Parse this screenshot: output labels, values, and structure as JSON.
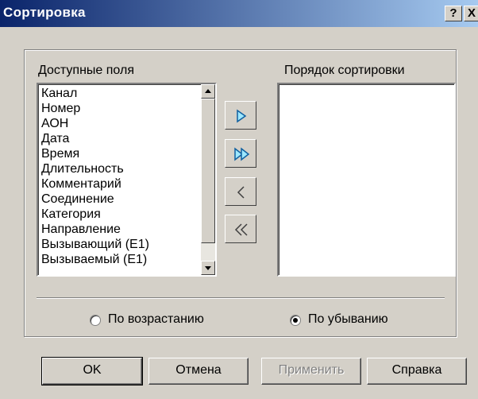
{
  "window": {
    "title": "Сортировка",
    "help_glyph": "?",
    "close_glyph": "X"
  },
  "available": {
    "label": "Доступные поля",
    "items": [
      "Канал",
      "Номер",
      "АОН",
      "Дата",
      "Время",
      "Длительность",
      "Комментарий",
      "Соединение",
      "Категория",
      "Направление",
      "Вызывающий (E1)"
    ],
    "partial_item": "Вызываемый (E1)"
  },
  "order": {
    "label": "Порядок сортировки",
    "items": []
  },
  "move_buttons": [
    "add-one",
    "add-all",
    "remove-one",
    "remove-all"
  ],
  "sort_direction": {
    "ascending_label": "По возрастанию",
    "descending_label": "По убыванию",
    "selected": "descending"
  },
  "buttons": {
    "ok": "OK",
    "cancel": "Отмена",
    "apply": "Применить",
    "help": "Справка"
  }
}
